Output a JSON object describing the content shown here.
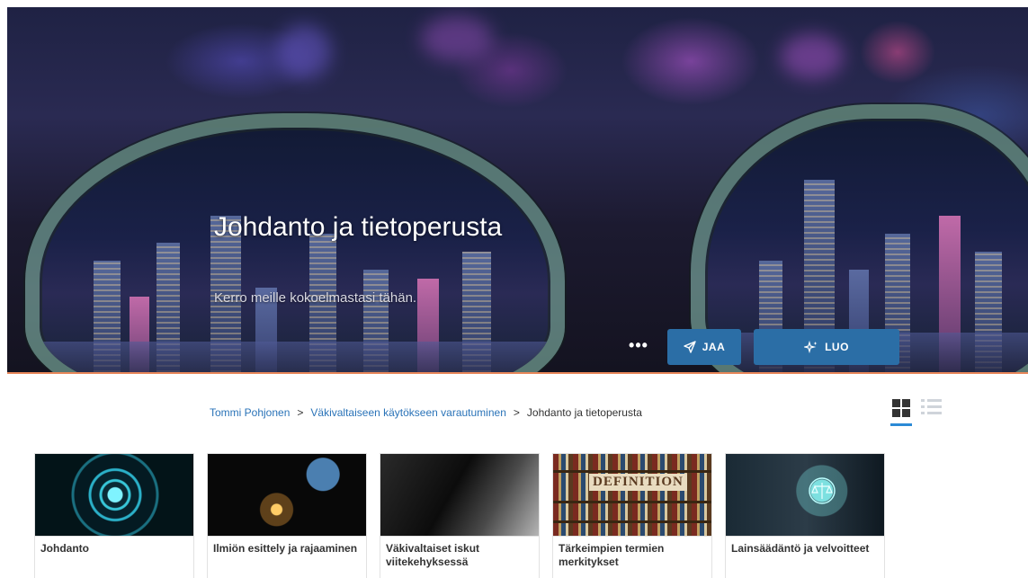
{
  "hero": {
    "title": "Johdanto ja tietoperusta",
    "subtitle": "Kerro meille kokoelmastasi tähän.",
    "more_label": "•••",
    "share_label": "JAA",
    "create_label": "LUO",
    "accent_color": "#2b6ea6",
    "divider_color": "#e8875a"
  },
  "breadcrumb": {
    "items": [
      "Tommi Pohjonen",
      "Väkivaltaiseen käytökseen varautuminen",
      "Johdanto ja tietoperusta"
    ],
    "separator": ">"
  },
  "view_toggle": {
    "active": "grid",
    "icons": [
      "grid-view-icon",
      "list-view-icon"
    ]
  },
  "cards": [
    {
      "title": "Johdanto",
      "icon": "tech-circle-image"
    },
    {
      "title": "Ilmiön esittely ja rajaaminen",
      "icon": "lighter-globe-image"
    },
    {
      "title": "Väkivaltaiset iskut viitekehyksessä",
      "icon": "silhouette-knife-image"
    },
    {
      "title": "Tärkeimpien termien merkitykset",
      "icon": "definition-books-image",
      "image_text": "DEFINITION"
    },
    {
      "title": "Lainsäädäntö ja velvoitteet",
      "icon": "scales-of-justice-image"
    }
  ]
}
